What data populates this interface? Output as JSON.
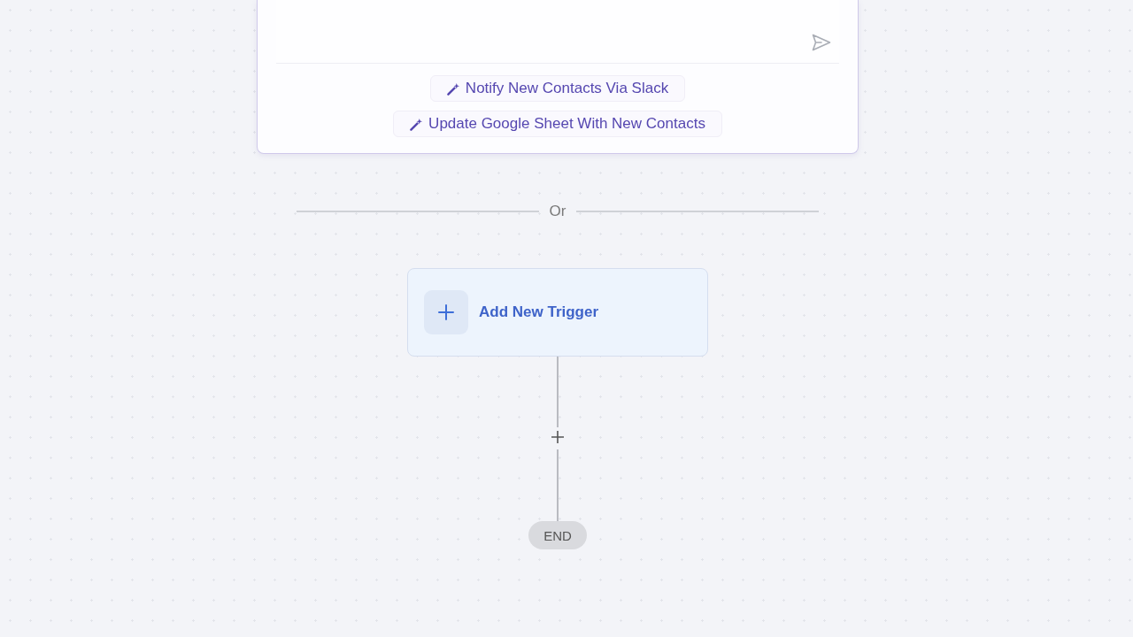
{
  "prompt_card": {
    "suggestions": [
      {
        "label": "Notify New Contacts Via Slack"
      },
      {
        "label": "Update Google Sheet With New Contacts"
      }
    ]
  },
  "divider": {
    "label": "Or"
  },
  "trigger": {
    "label": "Add New Trigger"
  },
  "flow": {
    "end_label": "END"
  }
}
